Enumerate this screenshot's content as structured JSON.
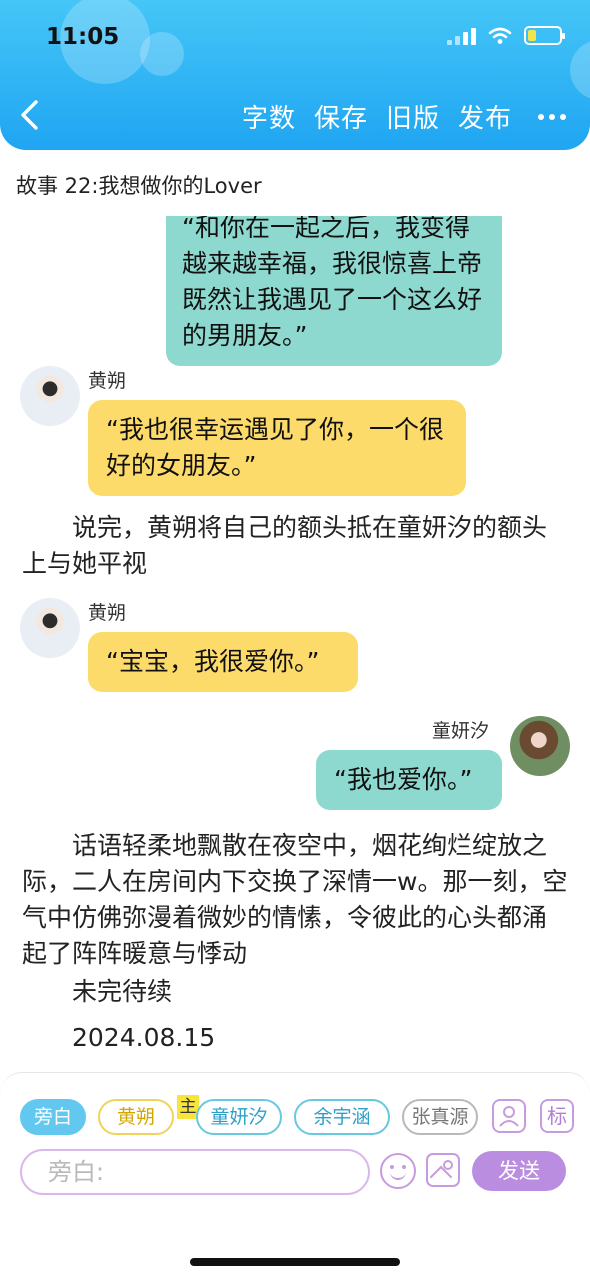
{
  "status_bar": {
    "time": "11:05"
  },
  "header": {
    "actions": [
      "字数",
      "保存",
      "旧版",
      "发布"
    ]
  },
  "story_title": "故事 22:我想做你的Lover",
  "messages": [
    {
      "text": "“和你在一起之后，我变得越来越幸福，我很惊喜上帝既然让我遇见了一个这么好的男朋友。”"
    },
    {
      "name": "黄朔",
      "text": "“我也很幸运遇见了你，一个很好的女朋友。”"
    },
    {
      "narration": "说完，黄朔将自己的额头抵在童妍汐的额头上与她平视"
    },
    {
      "name": "黄朔",
      "text": "“宝宝，我很爱你。”"
    },
    {
      "name": "童妍汐",
      "text": "“我也爱你。”"
    },
    {
      "narration": "话语轻柔地飘散在夜空中，烟花绚烂绽放之际，二人在房间内下交换了深情一w。那一刻，空气中仿佛弥漫着微妙的情愫，令彼此的心头都涌起了阵阵暖意与悸动"
    },
    {
      "narration": "未完待续"
    },
    {
      "narration": "2024.08.15"
    }
  ],
  "role_bar": {
    "roles": [
      "旁白",
      "黄朔",
      "童妍汐",
      "余宇涵",
      "张真源"
    ],
    "main_tag": "主",
    "mark_label": "标"
  },
  "composer": {
    "placeholder": "旁白:",
    "send_label": "发送"
  },
  "colors": {
    "header_blue": "#1fa5f2",
    "teal_bubble": "#8ed9cf",
    "yellow_bubble": "#fddb6b",
    "accent_purple": "#bb8de0"
  }
}
